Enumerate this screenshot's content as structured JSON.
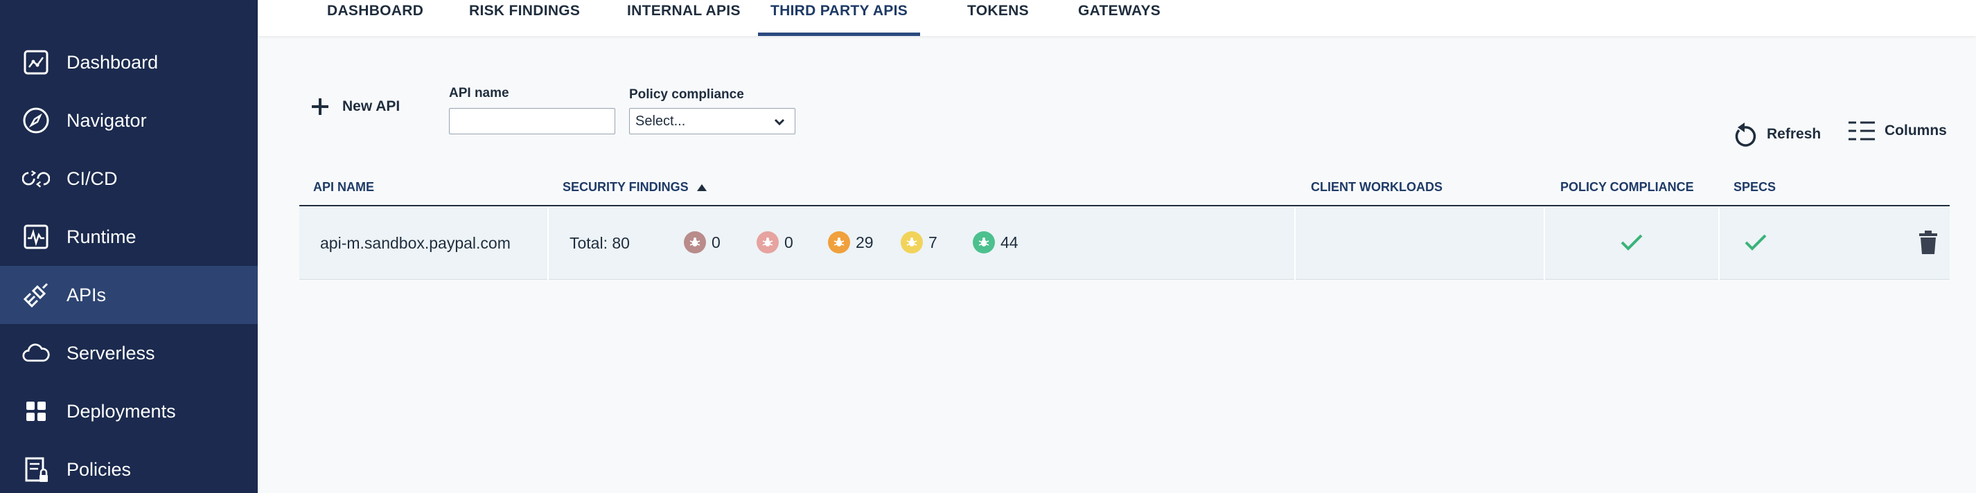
{
  "sidebar": {
    "items": [
      {
        "label": "Dashboard",
        "icon": "dashboard-icon"
      },
      {
        "label": "Navigator",
        "icon": "compass-icon"
      },
      {
        "label": "CI/CD",
        "icon": "cicd-icon"
      },
      {
        "label": "Runtime",
        "icon": "runtime-icon"
      },
      {
        "label": "APIs",
        "icon": "api-plug-icon",
        "active": true
      },
      {
        "label": "Serverless",
        "icon": "cloud-icon"
      },
      {
        "label": "Deployments",
        "icon": "grid-icon"
      },
      {
        "label": "Policies",
        "icon": "policy-lock-icon"
      }
    ]
  },
  "tabs": [
    {
      "label": "DASHBOARD"
    },
    {
      "label": "RISK FINDINGS"
    },
    {
      "label": "INTERNAL APIS"
    },
    {
      "label": "THIRD PARTY APIS",
      "active": true
    },
    {
      "label": "TOKENS"
    },
    {
      "label": "GATEWAYS"
    }
  ],
  "toolbar": {
    "new_api_label": "New API",
    "api_name_label": "API name",
    "api_name_value": "",
    "policy_label": "Policy compliance",
    "policy_value": "Select...",
    "refresh_label": "Refresh",
    "columns_label": "Columns"
  },
  "table": {
    "headers": [
      "API NAME",
      "SECURITY FINDINGS",
      "CLIENT WORKLOADS",
      "POLICY COMPLIANCE",
      "SPECS"
    ],
    "rows": [
      {
        "api_name": "api-m.sandbox.paypal.com",
        "total": "Total: 80",
        "findings": [
          {
            "level": "critical",
            "count": "0",
            "color": "#b98b8b"
          },
          {
            "level": "high",
            "count": "0",
            "color": "#e6a3a0"
          },
          {
            "level": "medium",
            "count": "29",
            "color": "#f0a03c"
          },
          {
            "level": "low",
            "count": "7",
            "color": "#f2d35a"
          },
          {
            "level": "info",
            "count": "44",
            "color": "#4cc08e"
          }
        ],
        "client_workloads": "",
        "policy_compliance": "check-icon",
        "specs": "check-icon"
      }
    ]
  },
  "colors": {
    "sidebar": "#1b2a4e",
    "sidebar_active": "#2d4472",
    "accent": "#2a4a7f",
    "check": "#3bb37a"
  }
}
